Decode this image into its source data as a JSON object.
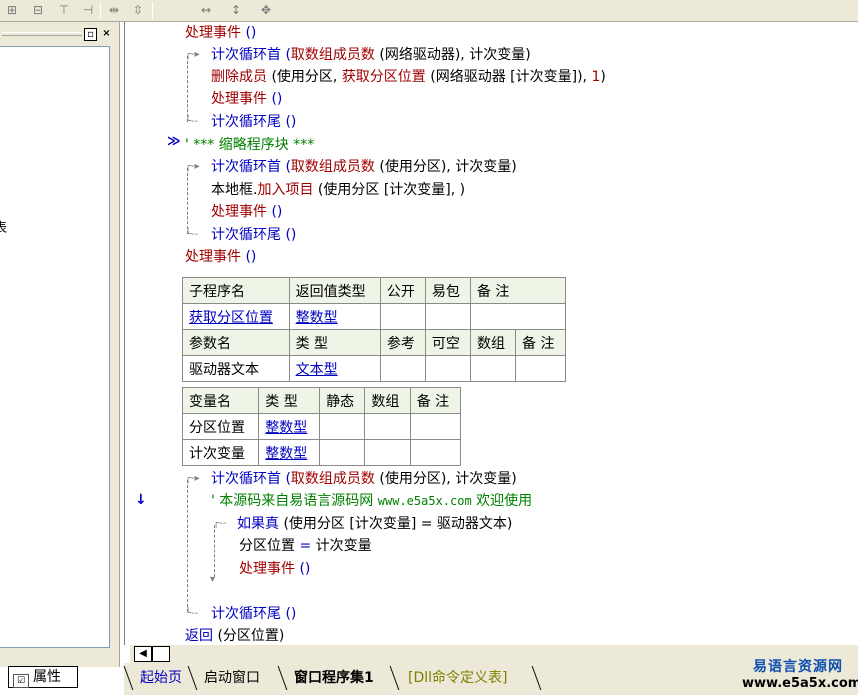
{
  "left_panel": {
    "clipped_text": "表",
    "restore_label": "▫",
    "close_label": "×",
    "props_tab": "属性"
  },
  "code": {
    "l1": {
      "a": "处理事件",
      "b": " ()"
    },
    "l2": {
      "a": "计次循环首",
      "b": " (",
      "c": "取数组成员数",
      "d": " (网络驱动器), 计次变量)"
    },
    "l3": {
      "a": "删除成员",
      "b": " (使用分区, ",
      "c": "获取分区位置",
      "d": " (网络驱动器 [计次变量]), ",
      "e": "1",
      "f": ")"
    },
    "l4": {
      "a": "处理事件",
      "b": " ()"
    },
    "l5": {
      "a": "计次循环尾",
      "b": " ()"
    },
    "l6": {
      "a": "' *** 缩略程序块 ***"
    },
    "l7": {
      "a": "计次循环首",
      "b": " (",
      "c": "取数组成员数",
      "d": " (使用分区), 计次变量)"
    },
    "l8": {
      "a": "本地框.",
      "b": "加入项目",
      "c": " (使用分区 [计次变量], )"
    },
    "l9": {
      "a": "处理事件",
      "b": " ()"
    },
    "l10": {
      "a": "计次循环尾",
      "b": " ()"
    },
    "l11": {
      "a": "处理事件",
      "b": " ()"
    },
    "l12": {
      "a": "计次循环首",
      "b": " (",
      "c": "取数组成员数",
      "d": " (使用分区), 计次变量)"
    },
    "l13": {
      "a": "' 本源码来自易语言源码网 ",
      "b": "www.e5a5x.com",
      "c": "  欢迎使用"
    },
    "l14": {
      "a": "如果真",
      "b": " (使用分区 [计次变量] = 驱动器文本)"
    },
    "l15": {
      "a": "分区位置 ",
      "b": "=",
      "c": " 计次变量"
    },
    "l16": {
      "a": "处理事件",
      "b": " ()"
    },
    "l17": {
      "a": "计次循环尾",
      "b": " ()"
    },
    "l18": {
      "a": "返回",
      "b": " (分区位置)"
    }
  },
  "sub_table": {
    "headers": [
      "子程序名",
      "返回值类型",
      "公开",
      "易包",
      "备 注"
    ],
    "row": [
      "获取分区位置",
      "整数型",
      "",
      "",
      ""
    ],
    "param_headers": [
      "参数名",
      "类 型",
      "参考",
      "可空",
      "数组",
      "备 注"
    ],
    "param_row": [
      "驱动器文本",
      "文本型",
      "",
      "",
      "",
      ""
    ]
  },
  "var_table": {
    "headers": [
      "变量名",
      "类 型",
      "静态",
      "数组",
      "备 注"
    ],
    "rows": [
      [
        "分区位置",
        "整数型",
        "",
        "",
        ""
      ],
      [
        "计次变量",
        "整数型",
        "",
        "",
        ""
      ]
    ]
  },
  "tabs": [
    "起始页",
    "启动窗口",
    "窗口程序集1",
    "[Dll命令定义表]"
  ],
  "watermark": {
    "line1": "易语言资源网",
    "line2": "www.e5a5x.com"
  },
  "colors": {
    "keyword": "#0000c0",
    "function": "#a00000",
    "comment": "#008000",
    "table_header": "#eef4e6"
  }
}
